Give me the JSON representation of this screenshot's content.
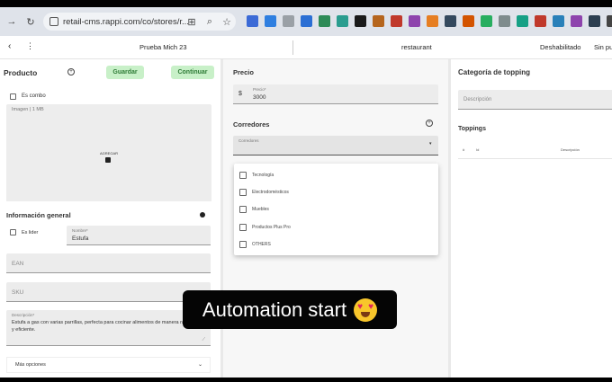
{
  "browser": {
    "url": "retail-cms.rappi.com/co/stores/r...",
    "extension_colors": [
      "#3b6ad6",
      "#2f7fe0",
      "#9aa0a6",
      "#2b6fd4",
      "#2e8b57",
      "#2a9d8f",
      "#1a1a1a",
      "#b5651d",
      "#c0392b",
      "#8e44ad",
      "#e67e22",
      "#34495e",
      "#d35400",
      "#27ae60",
      "#7f8c8d",
      "#16a085",
      "#c0392b",
      "#2980b9",
      "#8e44ad",
      "#2c3e50",
      "#444444"
    ]
  },
  "toolbar": {
    "store_name": "Prueba Mich 23",
    "category": "restaurant",
    "status": "Deshabilitado",
    "extra": "Sin pul"
  },
  "product": {
    "title": "Producto",
    "save_label": "Guardar",
    "continue_label": "Continuar",
    "combo_label": "Es combo",
    "images_label": "Imagen | 1 MB",
    "upload_label": "AGREGAR",
    "general_info_title": "Información general",
    "leader_label": "Es lider",
    "name_label": "Nombre*",
    "name_value": "Estufa",
    "ean_placeholder": "EAN",
    "sku_placeholder": "SKU",
    "description_label": "Descripción*",
    "description_value": "Estufa a gas con varias parrillas, perfecta para cocinar alimentos de manera rápida y eficiente.",
    "more_options": "Más opciones"
  },
  "pricing": {
    "title": "Precio",
    "currency": "$",
    "price_label": "Precio*",
    "price_value": "3000"
  },
  "corridors": {
    "title": "Corredores",
    "field_label": "Corredores",
    "options": [
      {
        "label": "Tecnología"
      },
      {
        "label": "Electrodomésticos"
      },
      {
        "label": "Muebles"
      },
      {
        "label": "Productos Plus Pro"
      },
      {
        "label": "OTHERS"
      }
    ]
  },
  "topping": {
    "category_title": "Categoría de topping",
    "description_placeholder": "Descripción",
    "toppings_title": "Toppings",
    "col_a": "#",
    "col_b": "Id",
    "col_c": "Descripción"
  },
  "overlay": {
    "text": "Automation start",
    "emoji": "heart-eyes-emoji"
  }
}
